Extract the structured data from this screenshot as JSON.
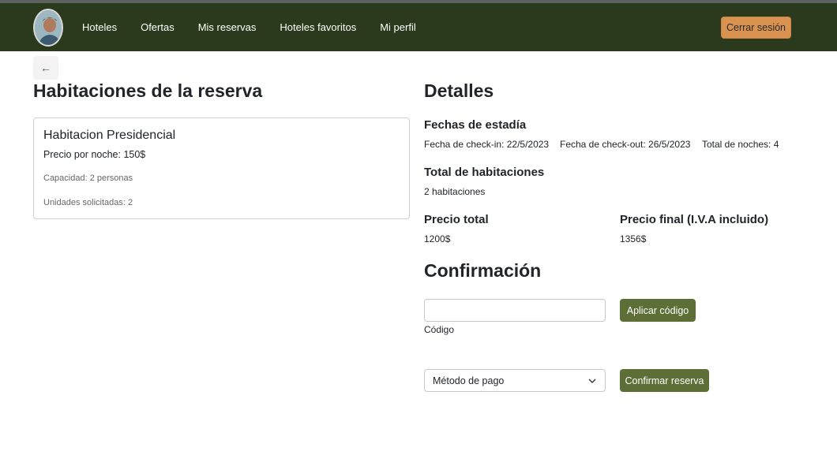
{
  "nav": {
    "links": [
      "Hoteles",
      "Ofertas",
      "Mis reservas",
      "Hoteles favoritos",
      "Mi perfil"
    ],
    "logout_label": "Cerrar sesión"
  },
  "back_icon": "←",
  "left": {
    "title": "Habitaciones de la reserva",
    "room": {
      "name": "Habitacion Presidencial",
      "price": "Precio por noche: 150$",
      "capacity": "Capacidad: 2 personas",
      "units": "Unidades solicitadas: 2"
    }
  },
  "details": {
    "title": "Detalles",
    "dates_title": "Fechas de estadía",
    "checkin": "Fecha de check-in: 22/5/2023",
    "checkout": "Fecha de check-out: 26/5/2023",
    "nights": "Total de noches: 4",
    "rooms_title": "Total de habitaciones",
    "rooms_value": "2 habitaciones",
    "price_title": "Precio total",
    "price_value": "1200$",
    "final_title": "Precio final (I.V.A incluido)",
    "final_value": "1356$"
  },
  "confirm": {
    "title": "Confirmación",
    "code_value": "",
    "code_label": "Código",
    "apply_label": "Aplicar código",
    "payment_selected": "Método de pago",
    "confirm_label": "Confirmar reserva"
  },
  "colors": {
    "navbar": "#2b3a1c",
    "logout": "#d9924f",
    "green_button": "#5d6f36"
  }
}
